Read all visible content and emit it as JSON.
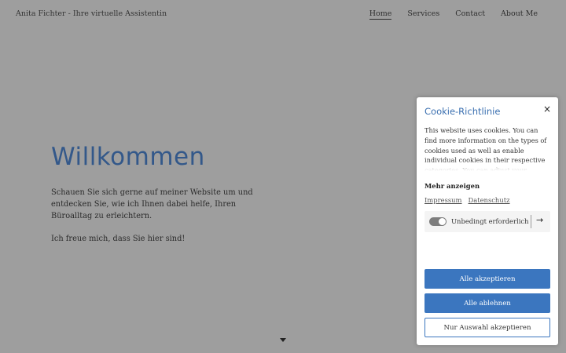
{
  "header": {
    "site_title": "Anita Fichter - Ihre virtuelle Assistentin",
    "nav": [
      {
        "label": "Home",
        "active": true
      },
      {
        "label": "Services",
        "active": false
      },
      {
        "label": "Contact",
        "active": false
      },
      {
        "label": "About Me",
        "active": false
      }
    ]
  },
  "hero": {
    "heading": "Willkommen",
    "paragraph1": "Schauen Sie sich gerne auf meiner Website um und entdecken Sie, wie ich Ihnen dabei helfe, Ihren Büroalltag zu erleichtern.",
    "paragraph2": "Ich freue mich, dass Sie hier sind!"
  },
  "cookie": {
    "title": "Cookie-Richtlinie",
    "close_symbol": "×",
    "body": "This website uses cookies. You can find more information on the types of cookies used as well as enable individual cookies in their respective categories. You can adjust your settings at any time through the link",
    "more_label": "Mehr anzeigen",
    "links": [
      "Impressum",
      "Datenschutz"
    ],
    "category": {
      "label": "Unbedingt erforderlich",
      "enabled": true
    },
    "buttons": {
      "accept_all": "Alle akzeptieren",
      "reject_all": "Alle ablehnen",
      "accept_selection": "Nur Auswahl akzeptieren"
    }
  },
  "colors": {
    "backdrop": "#9e9e9e",
    "heading": "#33588a",
    "accent": "#3b76bf"
  }
}
